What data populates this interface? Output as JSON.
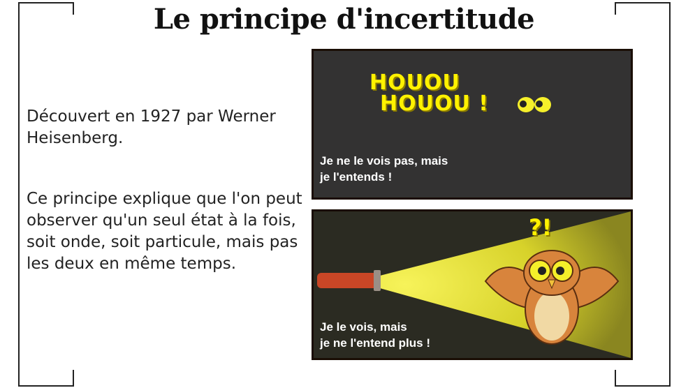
{
  "title": "Le principe d'incertitude",
  "paragraphs": [
    "Découvert en 1927 par Werner Heisenberg.",
    "Ce principe explique que l'on peut observer qu'un seul état à la fois, soit onde, soit particule, mais pas les deux en même temps."
  ],
  "comic_top": {
    "line1": "HOUOU",
    "line2": "HOUOU !",
    "caption_line1": "Je ne le vois pas, mais",
    "caption_line2": "je l'entends !"
  },
  "comic_bottom": {
    "exclamation": "?!",
    "caption_line1": "Je le vois, mais",
    "caption_line2": "je ne l'entend plus !"
  },
  "colors": {
    "panel_dark": "#333232",
    "yellow_text": "#fff200",
    "beam": "#e6e22a",
    "flashlight": "#d2472a",
    "owl": "#d8843c"
  }
}
